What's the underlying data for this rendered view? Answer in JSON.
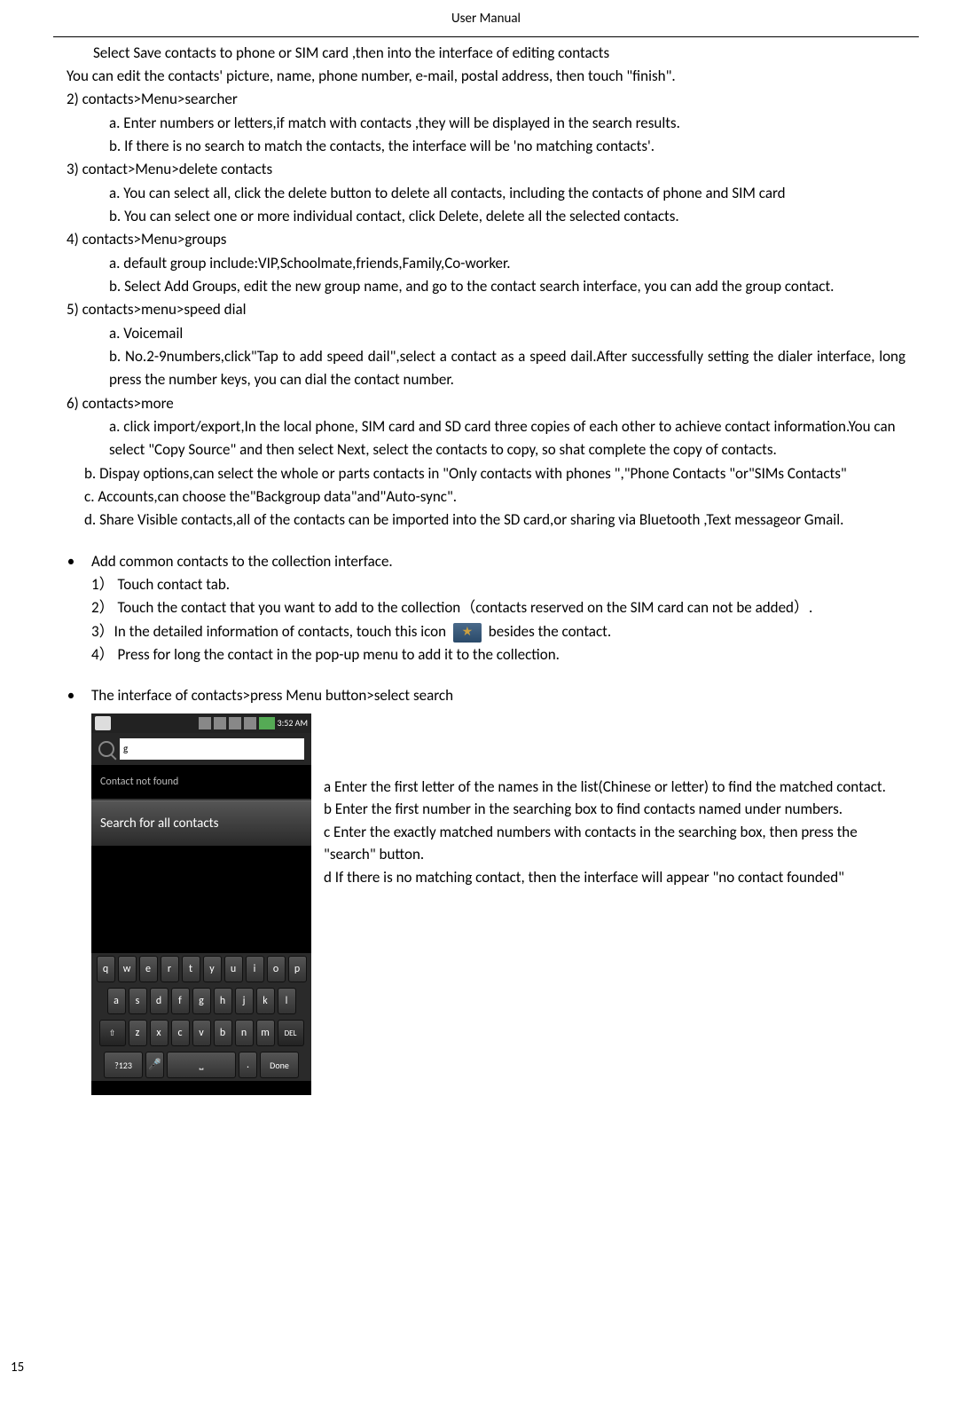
{
  "header": {
    "title": "User Manual"
  },
  "pageNumber": "15",
  "p": {
    "l1": "Select Save contacts to phone or SIM card ,then into the interface of editing contacts",
    "l2": "You can edit the contacts' picture, name, phone number, e-mail, postal address, then touch \"finish\".",
    "l3": "2) contacts>Menu>searcher",
    "l4": "a. Enter numbers or letters,if match with contacts ,they will be displayed in the search results.",
    "l5": "b. If there is no search to match the contacts, the interface will be 'no matching contacts'.",
    "l6": "3) contact>Menu>delete contacts",
    "l7": "a. You can select all, click the delete button to delete all contacts, including the contacts of phone and SIM card",
    "l8": "b. You can select one or more individual contact, click Delete, delete all the selected contacts.",
    "l9": "4) contacts>Menu>groups",
    "l10": "a. default group include:VIP,Schoolmate,friends,Family,Co-worker.",
    "l11": "b. Select Add Groups, edit the new group name, and go to the contact search interface, you can add the group contact.",
    "l12": "5) contacts>menu>speed dial",
    "l13": "a. Voicemail",
    "l14": "b. No.2-9numbers,click\"Tap to add speed dail\",select a contact as a speed dail.After successfully setting the dialer interface, long press the number keys, you can dial the contact number.",
    "l15": "6) contacts>more",
    "l16": "a. click import/export,In the local phone, SIM card and SD card three copies of each other to achieve contact information.You can select \"Copy Source\" and then select Next, select the contacts to copy, so shat complete the copy of contacts.",
    "l17": "b.  Dispay options,can select the whole or parts contacts in \"Only contacts with phones \",\"Phone Contacts \"or\"SIMs Contacts\"",
    "l18": "c.    Accounts,can choose the\"Backgroup data\"and\"Auto-sync\".",
    "l19": "d.   Share Visible contacts,all of the contacts can be imported into the SD card,or sharing via Bluetooth ,Text messageor Gmail.",
    "b1_label": "Add common contacts to the collection interface.",
    "b1_1": "1）  Touch contact tab.",
    "b1_2": "2）  Touch the contact that you want to add to the collection（contacts reserved on the SIM card can not be added）.",
    "b1_3a": "3）In the detailed information of contacts, touch this icon",
    "b1_3b": "besides the contact.",
    "b1_4": "4）  Press for long the contact in the pop-up menu to add it to the collection.",
    "b2_label": "The interface of contacts>press Menu button>select search",
    "r1": "a Enter the first letter of the names in the list(Chinese or letter) to find the matched contact.",
    "r2": "b Enter the first number in the searching box to find contacts named under numbers.",
    "r3": "c Enter the exactly matched numbers with contacts in the searching box, then press the \"search\" button.",
    "r4": "d If there is no matching contact, then the interface will appear \"no contact founded\""
  },
  "phone": {
    "time": "3:52 AM",
    "searchValue": "g",
    "notFound": "Contact not found",
    "searchAll": "Search for all contacts",
    "row1": [
      "q",
      "w",
      "e",
      "r",
      "t",
      "y",
      "u",
      "i",
      "o",
      "p"
    ],
    "row2": [
      "a",
      "s",
      "d",
      "f",
      "g",
      "h",
      "j",
      "k",
      "l"
    ],
    "row3_shift": "⇧",
    "row3": [
      "z",
      "x",
      "c",
      "v",
      "b",
      "n",
      "m"
    ],
    "row3_del": "DEL",
    "row4_sym": "?123",
    "row4_mic": "🎤",
    "row4_dot": ".",
    "row4_done": "Done"
  }
}
